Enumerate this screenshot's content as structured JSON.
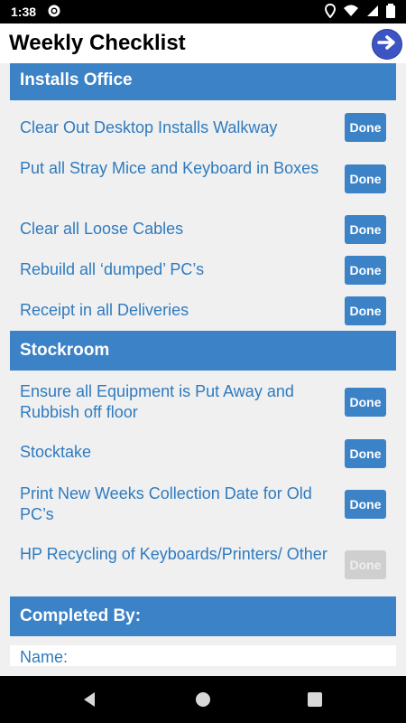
{
  "status": {
    "time": "1:38"
  },
  "app": {
    "title": "Weekly Checklist"
  },
  "sections": {
    "installs": "Installs Office",
    "stockroom": "Stockroom",
    "completed": "Completed By:"
  },
  "items": [
    {
      "text": "Clear Out Desktop Installs Walkway",
      "button": "Done",
      "enabled": true
    },
    {
      "text": "Put all Stray Mice and Keyboard in Boxes",
      "button": "Done",
      "enabled": true
    },
    {
      "text": "Clear all Loose Cables",
      "button": "Done",
      "enabled": true
    },
    {
      "text": "Rebuild all ‘dumped’ PC’s",
      "button": "Done",
      "enabled": true
    },
    {
      "text": "Receipt in all Deliveries",
      "button": "Done",
      "enabled": true
    },
    {
      "text": "Ensure all Equipment is Put Away and Rubbish off floor",
      "button": "Done",
      "enabled": true
    },
    {
      "text": "Stocktake",
      "button": "Done",
      "enabled": true
    },
    {
      "text": "Print New Weeks Collection Date for Old PC’s",
      "button": "Done",
      "enabled": true
    },
    {
      "text": "HP Recycling of Keyboards/Printers/ Other",
      "button": "Done",
      "enabled": false
    }
  ],
  "form": {
    "name_label": "Name:"
  },
  "colors": {
    "accent": "#3b82c7",
    "text_blue": "#2f7bbf",
    "next_button": "#3d55c4"
  }
}
